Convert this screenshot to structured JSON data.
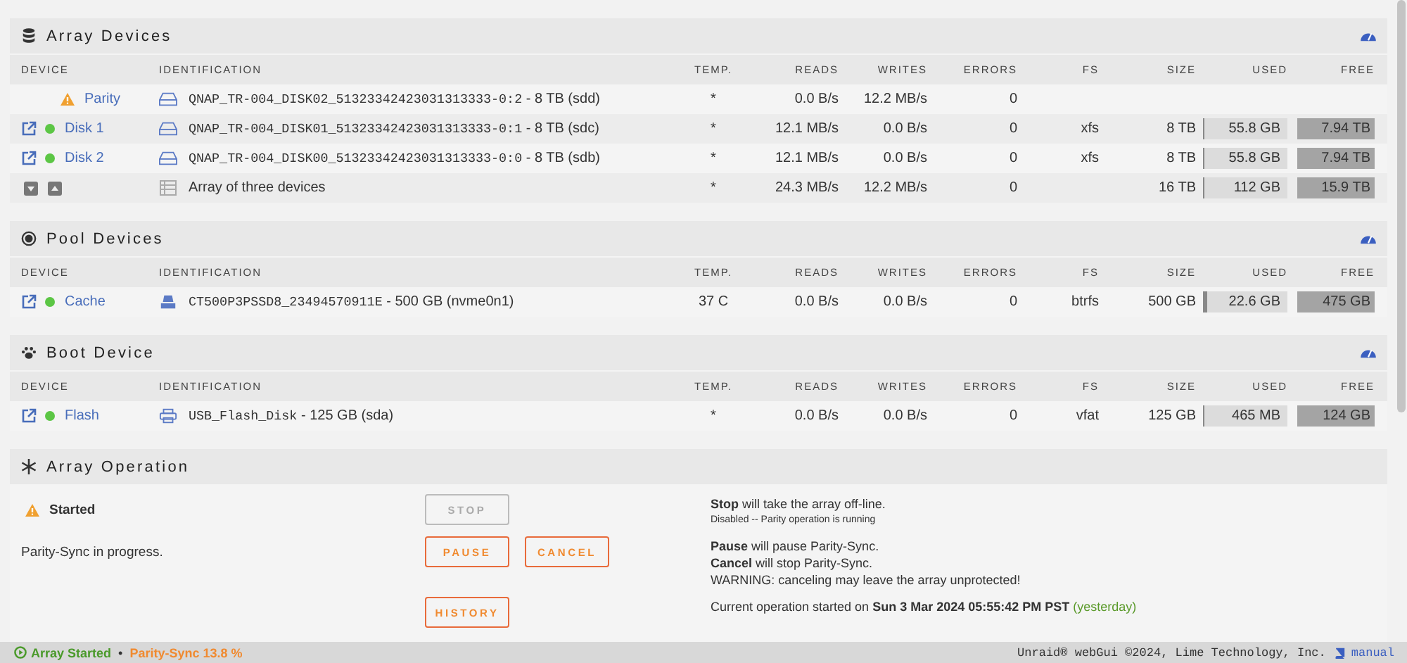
{
  "sections": [
    {
      "kind": "array",
      "title": "Array Devices",
      "columns": [
        "DEVICE",
        "IDENTIFICATION",
        "TEMP.",
        "READS",
        "WRITES",
        "ERRORS",
        "FS",
        "SIZE",
        "USED",
        "FREE"
      ],
      "rows": [
        {
          "kind": "device",
          "status": {
            "kind": "warning"
          },
          "link": false,
          "drive": {
            "kind": "hdd"
          },
          "name": "Parity",
          "id": "QNAP_TR-004_DISK02_51323342423031313333-0:2",
          "detail": "- 8 TB (sdd)",
          "temp": "*",
          "reads": "0.0 B/s",
          "writes": "12.2 MB/s",
          "errors": "0"
        },
        {
          "kind": "device",
          "status": {
            "kind": "ok"
          },
          "link": true,
          "drive": {
            "kind": "hdd"
          },
          "name": "Disk 1",
          "id": "QNAP_TR-004_DISK01_51323342423031313333-0:1",
          "detail": "- 8 TB (sdc)",
          "temp": "*",
          "reads": "12.1 MB/s",
          "writes": "0.0 B/s",
          "errors": "0",
          "fs": "xfs",
          "size": "8 TB",
          "used": {
            "text": "55.8 GB",
            "level": 0.007
          },
          "free": "7.94 TB"
        },
        {
          "kind": "device",
          "status": {
            "kind": "ok"
          },
          "link": true,
          "drive": {
            "kind": "hdd"
          },
          "name": "Disk 2",
          "id": "QNAP_TR-004_DISK00_51323342423031313333-0:0",
          "detail": "- 8 TB (sdb)",
          "temp": "*",
          "reads": "12.1 MB/s",
          "writes": "0.0 B/s",
          "errors": "0",
          "fs": "xfs",
          "size": "8 TB",
          "used": {
            "text": "55.8 GB",
            "level": 0.007
          },
          "free": "7.94 TB"
        },
        {
          "kind": "summary",
          "drive": {
            "kind": "list"
          },
          "label": "Array of three devices",
          "temp": "*",
          "reads": "24.3 MB/s",
          "writes": "12.2 MB/s",
          "errors": "0",
          "size": "16 TB",
          "used": {
            "text": "112 GB",
            "level": 0.007
          },
          "free": "15.9 TB"
        }
      ]
    },
    {
      "kind": "pool",
      "title": "Pool Devices",
      "columns": [
        "DEVICE",
        "IDENTIFICATION",
        "TEMP.",
        "READS",
        "WRITES",
        "ERRORS",
        "FS",
        "SIZE",
        "USED",
        "FREE"
      ],
      "rows": [
        {
          "kind": "device",
          "status": {
            "kind": "ok"
          },
          "link": true,
          "drive": {
            "kind": "nvme"
          },
          "name": "Cache",
          "id": "CT500P3PSSD8_23494570911E",
          "detail": "- 500 GB (nvme0n1)",
          "temp": "37 C",
          "reads": "0.0 B/s",
          "writes": "0.0 B/s",
          "errors": "0",
          "fs": "btrfs",
          "size": "500 GB",
          "used": {
            "text": "22.6 GB",
            "level": 0.045
          },
          "free": "475 GB"
        }
      ]
    },
    {
      "kind": "boot",
      "title": "Boot Device",
      "columns": [
        "DEVICE",
        "IDENTIFICATION",
        "TEMP.",
        "READS",
        "WRITES",
        "ERRORS",
        "FS",
        "SIZE",
        "USED",
        "FREE"
      ],
      "rows": [
        {
          "kind": "device",
          "status": {
            "kind": "ok"
          },
          "link": true,
          "drive": {
            "kind": "usb"
          },
          "name": "Flash",
          "id": "USB_Flash_Disk",
          "detail": "- 125 GB (sda)",
          "temp": "*",
          "reads": "0.0 B/s",
          "writes": "0.0 B/s",
          "errors": "0",
          "fs": "vfat",
          "size": "125 GB",
          "used": {
            "text": "465 MB",
            "level": 0.004
          },
          "free": "124 GB"
        }
      ]
    }
  ],
  "operation": {
    "title": "Array Operation",
    "rows": [
      {
        "status": {
          "text": "Started",
          "warning": true
        },
        "buttons": [
          {
            "label": "STOP",
            "disabled": true
          }
        ],
        "lines": [
          "**Stop** will take the array off-line."
        ],
        "note": "Disabled -- Parity operation is running"
      },
      {
        "status": {
          "text": "Parity-Sync in progress.",
          "warning": false
        },
        "buttons": [
          {
            "label": "PAUSE",
            "disabled": false
          },
          {
            "label": "CANCEL",
            "disabled": false
          }
        ],
        "lines": [
          "**Pause** will pause Parity-Sync.",
          "**Cancel** will stop Parity-Sync.",
          "WARNING: canceling may leave the array unprotected!"
        ]
      },
      {
        "buttons": [
          {
            "label": "HISTORY",
            "disabled": false
          }
        ],
        "started": {
          "text": "Current operation started on",
          "when": "Sun 3 Mar 2024 05:55:42 PM PST",
          "relative": "(yesterday)"
        }
      }
    ]
  },
  "footer": {
    "array": "Array Started",
    "separator": "•",
    "sync": "Parity-Sync 13.8 %",
    "copyright": "Unraid® webGui ©2024, Lime Technology, Inc.",
    "manual": "manual"
  }
}
